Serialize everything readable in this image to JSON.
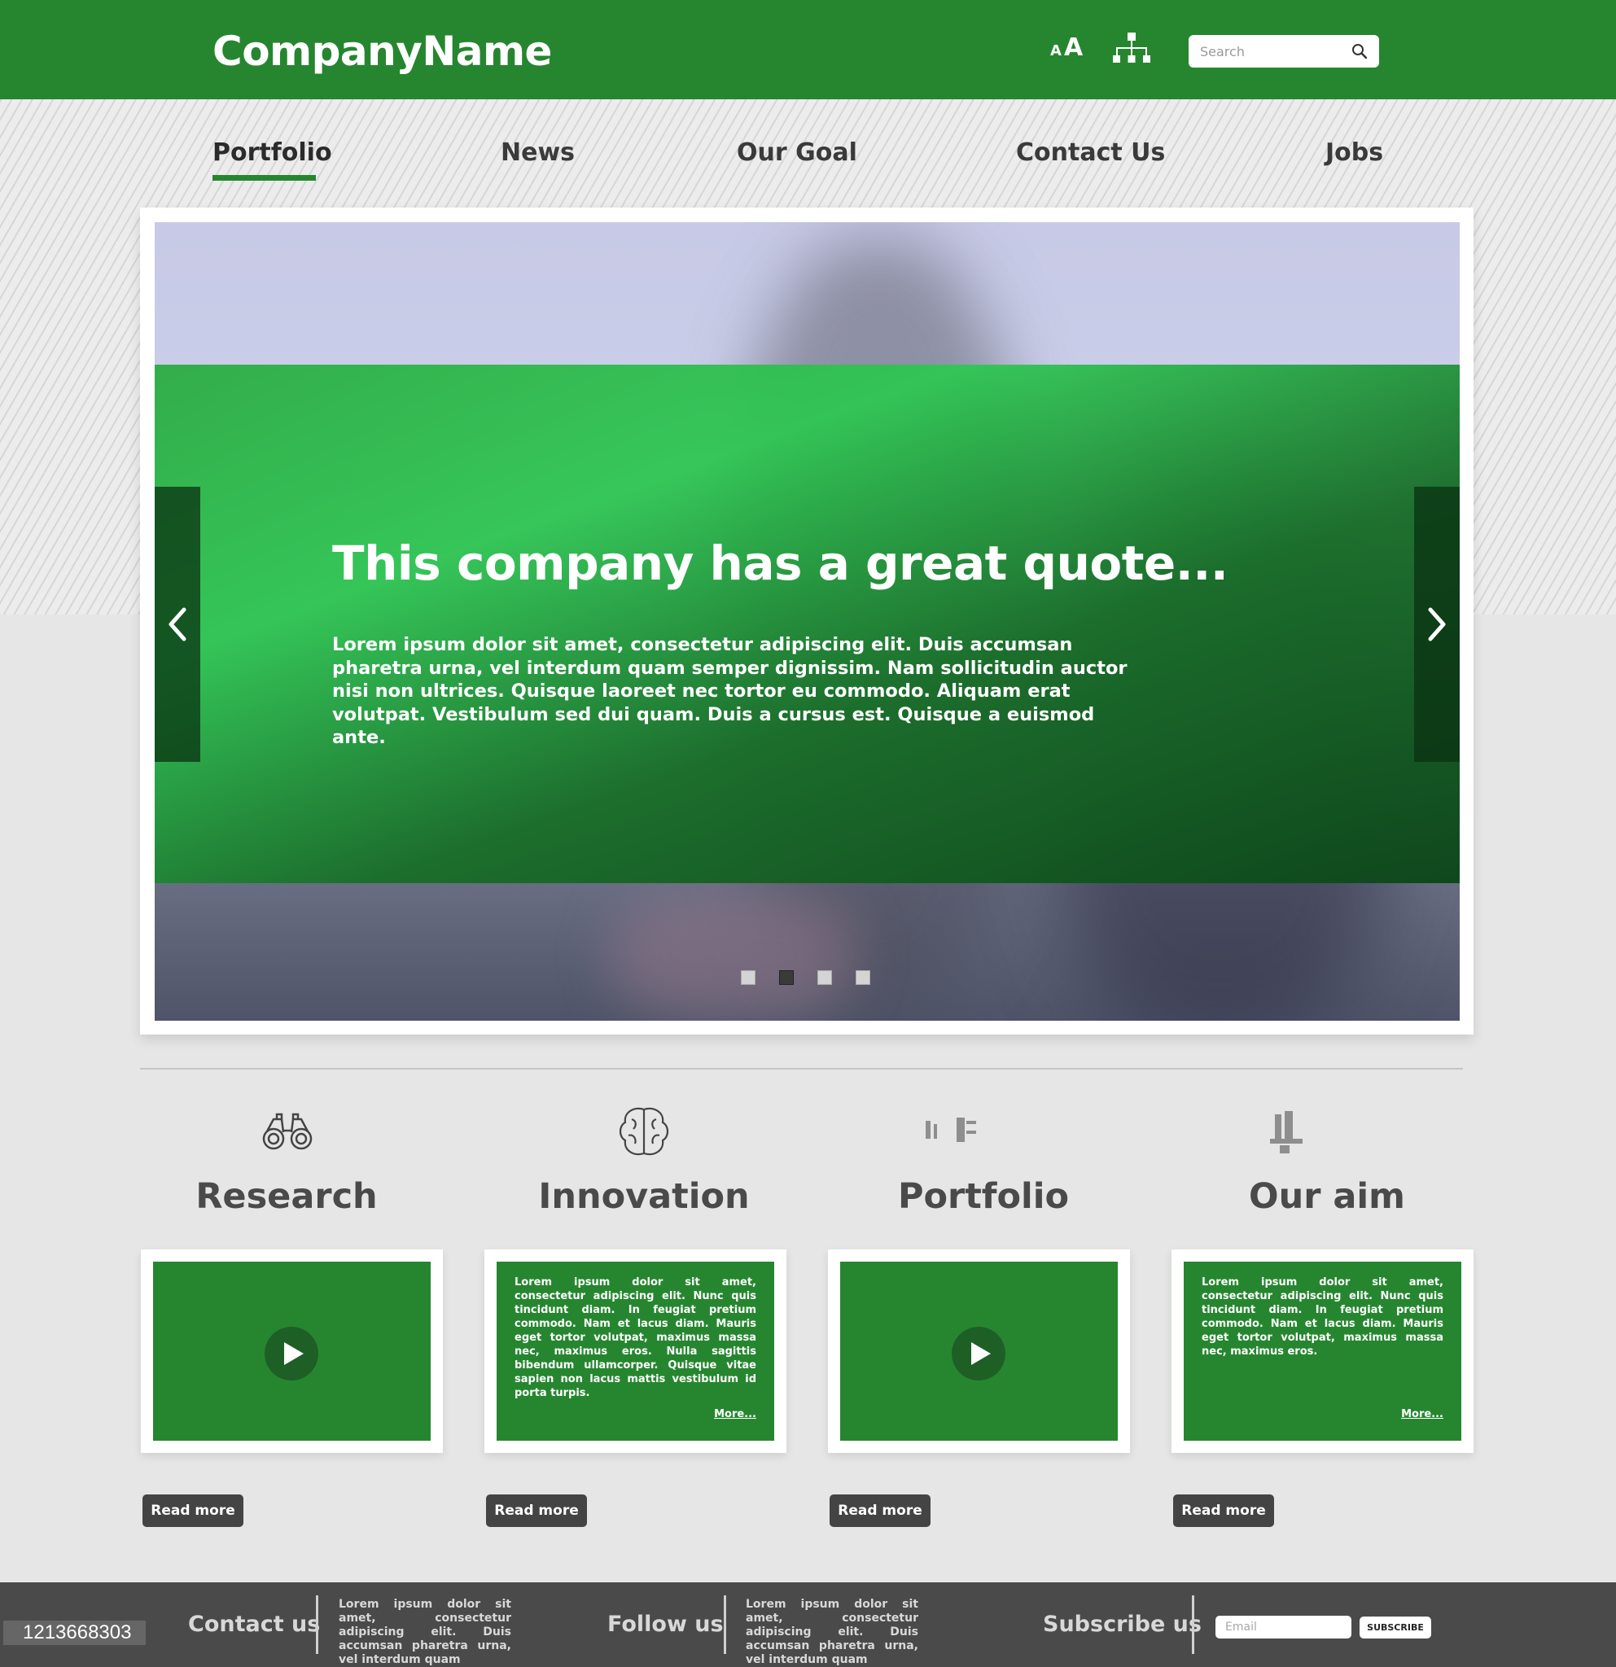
{
  "header": {
    "brand": "CompanyName",
    "font_small": "A",
    "font_large": "A",
    "search_placeholder": "Search",
    "search_icon": "search-icon",
    "sitemap_icon": "sitemap-icon"
  },
  "nav": {
    "items": [
      "Portfolio",
      "News",
      "Our Goal",
      "Contact Us",
      "Jobs"
    ],
    "active": "Portfolio"
  },
  "slider": {
    "title": "This company has a great quote...",
    "body": "Lorem ipsum dolor sit amet, consectetur adipiscing elit. Duis accumsan pharetra urna, vel interdum quam semper dignissim. Nam sollicitudin auctor nisi non ultrices. Quisque laoreet nec tortor eu commodo. Aliquam erat volutpat. Vestibulum sed dui quam. Duis a cursus est. Quisque a euismod ante.",
    "slide_count": 4,
    "active_slide": 2
  },
  "features": [
    {
      "title": "Research",
      "icon": "binoculars-icon",
      "card": "video",
      "button": "Read more"
    },
    {
      "title": "Innovation",
      "icon": "brain-icon",
      "card": "text",
      "text": "Lorem ipsum dolor sit amet, consectetur adipiscing elit. Nunc quis tincidunt diam. In feugiat pretium commodo. Nam et lacus diam. Mauris eget tortor volutpat, maximus massa nec, maximus eros. Nulla sagittis bibendum ullamcorper. Quisque vitae sapien non lacus mattis vestibulum id porta turpis.",
      "more": "More...",
      "button": "Read more"
    },
    {
      "title": "Portfolio",
      "icon": "portfolio-icon",
      "card": "video",
      "button": "Read more"
    },
    {
      "title": "Our aim",
      "icon": "aim-icon",
      "card": "text",
      "text": "Lorem ipsum dolor sit amet, consectetur adipiscing elit. Nunc quis tincidunt diam. In feugiat pretium commodo. Nam et lacus diam. Mauris eget tortor volutpat, maximus massa nec, maximus eros.",
      "more": "More...",
      "button": "Read more"
    }
  ],
  "footer": {
    "phone": "1213668303",
    "contact_heading": "Contact us",
    "contact_text": "Lorem ipsum dolor sit amet, consectetur adipiscing elit. Duis accumsan pharetra urna, vel interdum quam",
    "follow_heading": "Follow us",
    "follow_text": "Lorem ipsum dolor sit amet, consectetur adipiscing elit. Duis accumsan pharetra urna, vel interdum quam",
    "subscribe_heading": "Subscribe us",
    "email_placeholder": "Email",
    "subscribe_button": "SUBSCRIBE"
  },
  "colors": {
    "brand_green": "#26862f",
    "dark_green": "#1e5f26",
    "footer_bg": "#4a4a4a",
    "button_bg": "#444444"
  }
}
